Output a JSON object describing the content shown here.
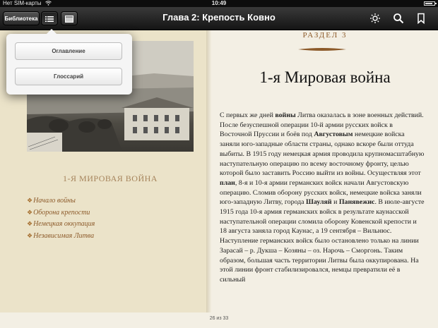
{
  "status_bar": {
    "carrier": "Нет SIM-карты",
    "time": "10:49",
    "battery_level": 0.85
  },
  "toolbar": {
    "library_label": "Библиотека",
    "title": "Глава 2: Крепость Ковно",
    "icons": [
      "list-icon",
      "page-view-icon",
      "brightness-icon",
      "search-icon",
      "bookmark-icon"
    ]
  },
  "popover": {
    "contents_label": "Оглавление",
    "glossary_label": "Глоссарий"
  },
  "left_page": {
    "heading": "1-Я МИРОВАЯ ВОЙНА",
    "toc_items": [
      "Начало войны",
      "Оборона крепости",
      "Немецкая оккупация",
      "Независимая Литва"
    ]
  },
  "right_page": {
    "section_label": "РАЗДЕЛ 3",
    "title": "1-я Мировая война",
    "paragraph": [
      {
        "t": "С первых же дней ",
        "b": false
      },
      {
        "t": "войны",
        "b": true
      },
      {
        "t": " Литва оказалась в зоне военных действий. После безуспешной операции 10-й армии русских войск в Восточной Пруссии и боёв под ",
        "b": false
      },
      {
        "t": "Августовым",
        "b": true
      },
      {
        "t": " немецкие войска заняли юго-западные области страны, однако вскоре были оттуда выбиты. В 1915 году немецкая армия проводила крупномасштабную наступательную операцию по всему восточному фронту, целью которой было заставить Россию выйти из войны. Осуществляя этот ",
        "b": false
      },
      {
        "t": "план",
        "b": true
      },
      {
        "t": ", 8-я и 10-я армии германских войск начали Августовскую операцию. Сломив оборону русских войск, немецкие войска заняли юго-западную Литву, города ",
        "b": false
      },
      {
        "t": "Шауляй",
        "b": true
      },
      {
        "t": " и ",
        "b": false
      },
      {
        "t": "Панявежис",
        "b": true
      },
      {
        "t": ". В июле-августе 1915 года 10-я армия германских войск в результате каунасской наступательной операции сломила оборону Ковенской крепости и 18 августа заняла город Каунас, а 19 сентября – Вильнюс. Наступление германских войск было остановлено только на линии Зарасай – р. Дукша – Козяны – оз. Нарочь – Сморгонь. Таким образом, большая часть территории Литвы была оккупирована. На этой линии фронт стабилизировался, немцы превратили её в сильный",
        "b": false
      }
    ]
  },
  "footer": {
    "page_indicator": "26 из 33"
  },
  "colors": {
    "toolbar": "#1f1f1f",
    "page": "#f3efe4",
    "left_page": "#ebe3c9",
    "accent": "#8c5a2a"
  }
}
